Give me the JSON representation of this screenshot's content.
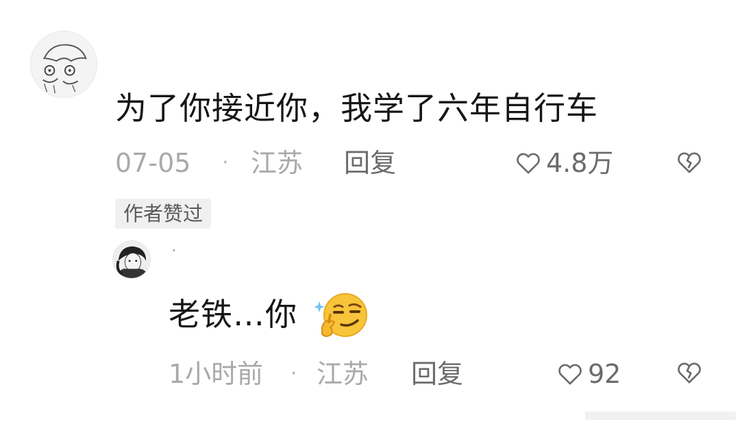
{
  "comment": {
    "text": "为了你接近你，我学了六年自行车",
    "date": "07-05",
    "location": "江苏",
    "reply_label": "回复",
    "like_count": "4.8万",
    "badge": "作者赞过"
  },
  "reply": {
    "username": "·",
    "text": "老铁…你",
    "time": "1小时前",
    "location": "江苏",
    "reply_label": "回复",
    "like_count": "92"
  },
  "separator": "·",
  "icons": {
    "like": "heart-outline-icon",
    "dislike": "broken-heart-icon",
    "emoji": "smirk-emoji"
  },
  "colors": {
    "text": "#161616",
    "meta": "#a9a9a9",
    "action": "#6b6b6b",
    "badge_bg": "#f0f0f0"
  }
}
